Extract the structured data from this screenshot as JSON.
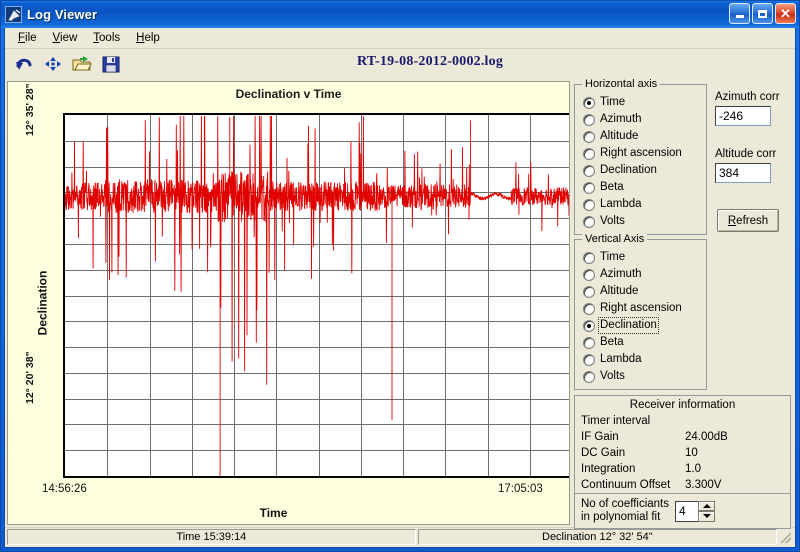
{
  "window": {
    "title": "Log Viewer",
    "icon": "satellite-dish-icon",
    "minimize_label": "Minimize",
    "maximize_label": "Maximize",
    "close_label": "Close"
  },
  "menu": [
    {
      "label": "File",
      "accel": "F"
    },
    {
      "label": "View",
      "accel": "V"
    },
    {
      "label": "Tools",
      "accel": "T"
    },
    {
      "label": "Help",
      "accel": "H"
    }
  ],
  "toolbar": {
    "buttons": [
      {
        "icon": "undo-arrow-icon",
        "label": "Undo"
      },
      {
        "icon": "move-arrows-icon",
        "label": "Pan"
      },
      {
        "icon": "open-folder-icon",
        "label": "Open"
      },
      {
        "icon": "save-floppy-icon",
        "label": "Save"
      }
    ],
    "file_title": "RT-19-08-2012-0002.log"
  },
  "chart_data": {
    "type": "line",
    "title": "Declination v Time",
    "xlabel": "Time",
    "ylabel": "Declination",
    "x_tick_labels": [
      "14:56:26",
      "17:05:03"
    ],
    "y_tick_labels": [
      "12° 35' 28\"",
      "12° 20' 38\""
    ],
    "grid": true,
    "grid_cols": 12,
    "grid_rows": 14,
    "series_color": "#e00000",
    "legend": "none",
    "xlim": [
      "14:56:26",
      "17:05:03"
    ],
    "ylim": [
      "12° 20' 38\"",
      "12° 35' 28\""
    ],
    "description": "Dense red noise trace confined to the upper portion of the plot, with a broad high-variance burst in the first half, two deep negative spikes dropping to near the bottom of the frame, and a smoother low-noise tail in the final fifth.",
    "baseline_y_fraction": 0.225,
    "noise_band_fraction": 0.06,
    "series": [
      {
        "name": "Declination",
        "segments": [
          {
            "x_start": 0.0,
            "x_end": 0.08,
            "amplitude": 0.07,
            "density": "high"
          },
          {
            "x_start": 0.08,
            "x_end": 0.3,
            "amplitude": 0.085,
            "density": "high"
          },
          {
            "x_start": 0.3,
            "x_end": 0.4,
            "amplitude": 0.13,
            "density": "very-high"
          },
          {
            "x_start": 0.4,
            "x_end": 0.62,
            "amplitude": 0.075,
            "density": "high"
          },
          {
            "x_start": 0.62,
            "x_end": 0.8,
            "amplitude": 0.06,
            "density": "medium"
          },
          {
            "x_start": 0.8,
            "x_end": 0.88,
            "amplitude": 0.02,
            "density": "low"
          },
          {
            "x_start": 0.88,
            "x_end": 1.0,
            "amplitude": 0.045,
            "density": "medium"
          }
        ],
        "deep_spikes": [
          {
            "x": 0.306,
            "depth_fraction": 1.0
          },
          {
            "x": 0.645,
            "depth_fraction": 0.8
          }
        ],
        "tall_spikes": [
          {
            "x": 0.8,
            "height_fraction": 0.36
          },
          {
            "x": 0.275,
            "height_fraction": 0.44
          },
          {
            "x": 0.325,
            "height_fraction": 0.47
          }
        ]
      }
    ]
  },
  "horizontal_axis": {
    "title": "Horizontal axis",
    "options": [
      "Time",
      "Azimuth",
      "Altitude",
      "Right ascension",
      "Declination",
      "Beta",
      "Lambda",
      "Volts"
    ],
    "selected": "Time",
    "focused": null
  },
  "vertical_axis": {
    "title": "Vertical Axis",
    "options": [
      "Time",
      "Azimuth",
      "Altitude",
      "Right ascension",
      "Declination",
      "Beta",
      "Lambda",
      "Volts"
    ],
    "selected": "Declination",
    "focused": "Declination"
  },
  "corrections": {
    "azimuth_label": "Azimuth corr",
    "azimuth_value": "-246",
    "altitude_label": "Altitude corr",
    "altitude_value": "384",
    "refresh_label": "Refresh",
    "refresh_accel": "R"
  },
  "receiver_info": {
    "title": "Receiver information",
    "rows": [
      {
        "key": "Timer interval",
        "value": ""
      },
      {
        "key": "IF Gain",
        "value": "24.00dB"
      },
      {
        "key": "DC Gain",
        "value": "10"
      },
      {
        "key": "Integration",
        "value": "1.0"
      },
      {
        "key": "Continuum Offset",
        "value": "3.300V"
      }
    ],
    "coefficients_caption_line1": "No of coefficiants",
    "coefficients_caption_line2": "in polynomial fit",
    "coefficients_value": "4"
  },
  "statusbar": {
    "time": "Time 15:39:14",
    "declination": "Declination 12° 32' 54\""
  },
  "colors": {
    "titlebar_blue": "#0a55c4",
    "chart_bg": "#ffffe0",
    "trace_red": "#e00000",
    "face": "#ece9d8",
    "file_title": "#1a1a6e"
  }
}
